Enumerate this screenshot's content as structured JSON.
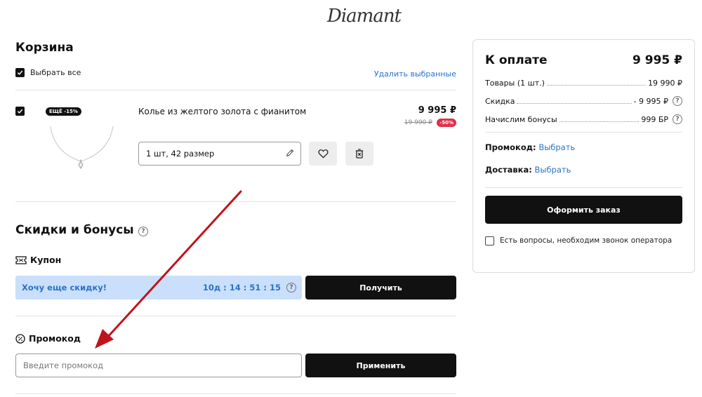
{
  "header": {
    "logo_text": "Diamant"
  },
  "cart": {
    "title": "Корзина",
    "select_all_label": "Выбрать все",
    "select_all_checked": true,
    "delete_selected_label": "Удалить выбранные",
    "item": {
      "checked": true,
      "badge": "ЕЩЁ -15%",
      "name": "Колье из желтого золота с фианитом",
      "price": "9 995 ₽",
      "old_price": "19 990 ₽",
      "discount_badge": "-50%",
      "size_value": "1 шт, 42 размер",
      "icons": [
        "pencil-icon",
        "heart-icon",
        "trash-icon"
      ]
    }
  },
  "discounts": {
    "title": "Скидки и бонусы",
    "coupon": {
      "heading": "Купон",
      "offer_text": "Хочу еще скидку!",
      "timer": "10д : 14 : 51 : 15",
      "button_label": "Получить"
    },
    "promo": {
      "heading": "Промокод",
      "placeholder": "Введите промокод",
      "value": "",
      "button_label": "Применить"
    }
  },
  "summary": {
    "title": "К оплате",
    "total": "9 995 ₽",
    "rows": [
      {
        "label": "Товары (1 шт.)",
        "value": "19 990 ₽"
      },
      {
        "label": "Скидка",
        "value": "- 9 995 ₽"
      },
      {
        "label": "Начислим бонусы",
        "value": "999 БР"
      }
    ],
    "promo_label": "Промокод:",
    "promo_link": "Выбрать",
    "delivery_label": "Доставка:",
    "delivery_link": "Выбрать",
    "checkout_label": "Оформить заказ",
    "operator_label": "Есть вопросы, необходим звонок оператора",
    "operator_checked": false
  },
  "colors": {
    "accent_link": "#2a73c8",
    "coupon_bg": "#c9dffb",
    "discount_badge": "#e0304a",
    "annotation_arrow": "#c0141c"
  }
}
